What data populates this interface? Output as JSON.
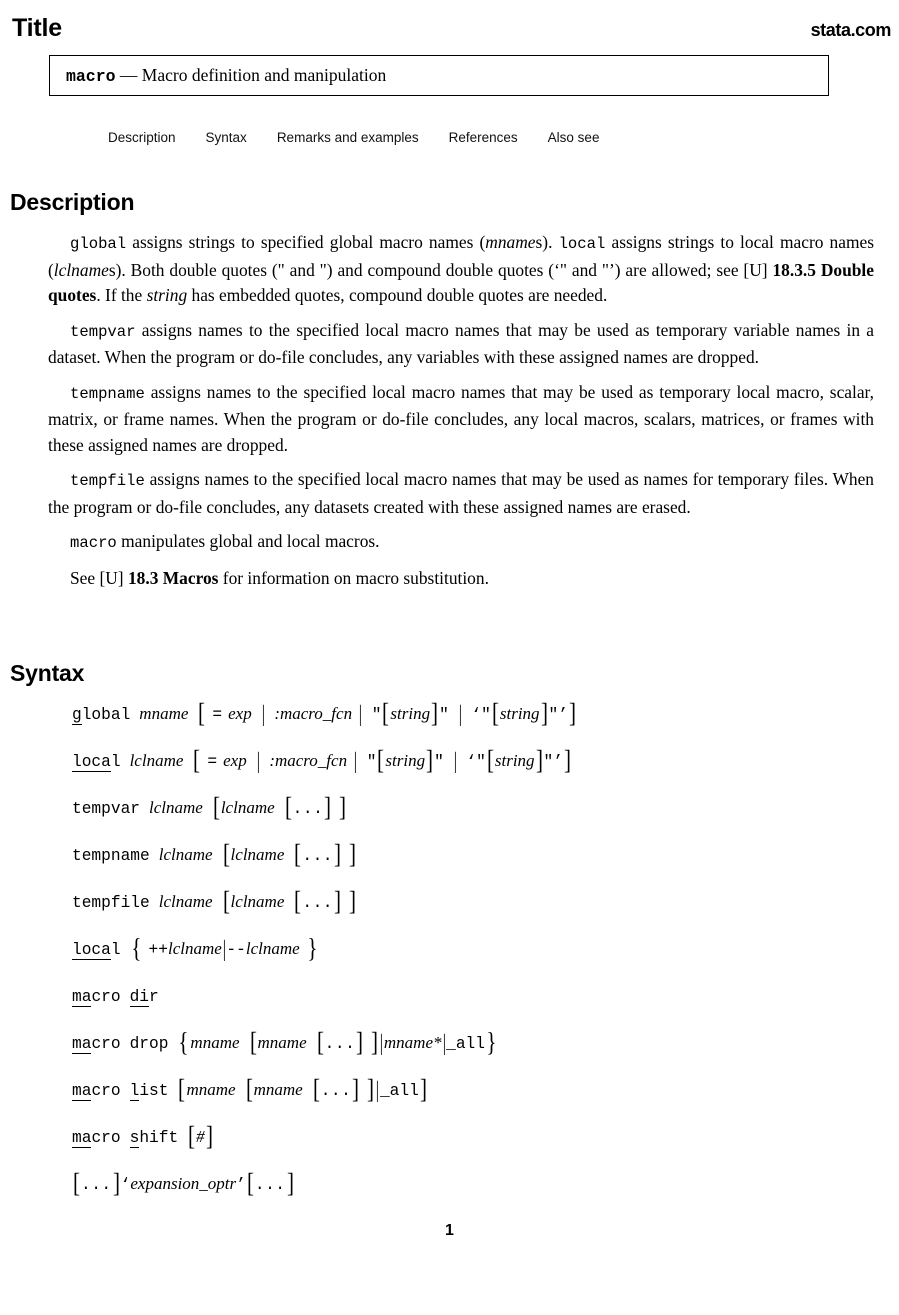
{
  "header": {
    "title": "Title",
    "logo": "stata.com"
  },
  "title_box": {
    "command": "macro",
    "dash": "—",
    "description": "Macro definition and manipulation"
  },
  "nav": {
    "items": [
      {
        "label": "Description"
      },
      {
        "label": "Syntax"
      },
      {
        "label": "Remarks and examples"
      },
      {
        "label": "References"
      },
      {
        "label": "Also see"
      }
    ]
  },
  "sections": {
    "description_heading": "Description",
    "syntax_heading": "Syntax"
  },
  "description": {
    "p1": {
      "s1": "global",
      "s2": " assigns strings to specified global macro names (",
      "s3": "mname",
      "s4": "s). ",
      "s5": "local",
      "s6": " assigns strings to local macro names (",
      "s7": "lclname",
      "s8": "s). Both double quotes (\" and \") and compound double quotes (‘\" and \"’) are allowed; see [U] ",
      "s9": "18.3.5 Double quotes",
      "s10": ". If the ",
      "s11": "string",
      "s12": " has embedded quotes, compound double quotes are needed."
    },
    "p2": {
      "s1": "tempvar",
      "s2": " assigns names to the specified local macro names that may be used as temporary variable names in a dataset. When the program or do-file concludes, any variables with these assigned names are dropped."
    },
    "p3": {
      "s1": "tempname",
      "s2": " assigns names to the specified local macro names that may be used as temporary local macro, scalar, matrix, or frame names. When the program or do-file concludes, any local macros, scalars, matrices, or frames with these assigned names are dropped."
    },
    "p4": {
      "s1": "tempfile",
      "s2": " assigns names to the specified local macro names that may be used as names for temporary files. When the program or do-file concludes, any datasets created with these assigned names are erased."
    },
    "p5": {
      "s1": "macro",
      "s2": " manipulates global and local macros."
    },
    "p6": {
      "s1": "See [U] ",
      "s2": "18.3 Macros",
      "s3": " for information on macro substitution."
    }
  },
  "syntax": {
    "line_global": {
      "kw_u": "g",
      "kw_rest": "lobal",
      "arg1": "mname",
      "open1": "[",
      "eq": "=",
      "exp": "exp",
      "bar1": "|",
      "macro_fcn": ":macro_fcn",
      "bar2": "|",
      "quote_open": "\"",
      "open2": "[",
      "string1": "string",
      "close2": "]",
      "quote_close": "\"",
      "bar3": "|",
      "cquote_open": "‘\"",
      "open3": "[",
      "string2": "string",
      "close3": "]",
      "cquote_close": "\"’",
      "close1": "]"
    },
    "line_local": {
      "kw_u": "loca",
      "kw_rest": "l",
      "arg1": "lclname",
      "open1": "[",
      "eq": "=",
      "exp": "exp",
      "bar1": "|",
      "macro_fcn": ":macro_fcn",
      "bar2": "|",
      "quote_open": "\"",
      "open2": "[",
      "string1": "string",
      "close2": "]",
      "quote_close": "\"",
      "bar3": "|",
      "cquote_open": "‘\"",
      "open3": "[",
      "string2": "string",
      "close3": "]",
      "cquote_close": "\"’",
      "close1": "]"
    },
    "line_tempvar": {
      "kw": "tempvar",
      "arg1": "lclname",
      "open1": "[",
      "arg2": "lclname",
      "open2": "[",
      "dots": "...",
      "close2": "]",
      "close1": "]"
    },
    "line_tempname": {
      "kw": "tempname",
      "arg1": "lclname",
      "open1": "[",
      "arg2": "lclname",
      "open2": "[",
      "dots": "...",
      "close2": "]",
      "close1": "]"
    },
    "line_tempfile": {
      "kw": "tempfile",
      "arg1": "lclname",
      "open1": "[",
      "arg2": "lclname",
      "open2": "[",
      "dots": "...",
      "close2": "]",
      "close1": "]"
    },
    "line_local_incr": {
      "kw_u": "loca",
      "kw_rest": "l",
      "brace_open": "{",
      "incr": "++",
      "arg1": "lclname",
      "bar1": "|",
      "decr": "--",
      "arg2": "lclname",
      "brace_close": "}"
    },
    "line_macro_dir": {
      "kw_u": "ma",
      "kw_rest": "cro",
      "sub_u": "di",
      "sub_rest": "r"
    },
    "line_macro_drop": {
      "kw_u": "ma",
      "kw_rest": "cro",
      "sub": "drop",
      "brace_open": "{",
      "arg1": "mname",
      "open1": "[",
      "arg2": "mname",
      "open2": "[",
      "dots": "...",
      "close2": "]",
      "close1": "]",
      "bar1": "|",
      "arg3": "mname*",
      "bar2": "|",
      "all": "_all",
      "brace_close": "}"
    },
    "line_macro_list": {
      "kw_u": "ma",
      "kw_rest": "cro",
      "sub_u": "l",
      "sub_rest": "ist",
      "open1": "[",
      "arg1": "mname",
      "open2": "[",
      "arg2": "mname",
      "open3": "[",
      "dots": "...",
      "close3": "]",
      "close2": "]",
      "bar1": "|",
      "all": "_all",
      "close1": "]"
    },
    "line_macro_shift": {
      "kw_u": "ma",
      "kw_rest": "cro",
      "sub_u": "s",
      "sub_rest": "hift",
      "open1": "[",
      "hash": "#",
      "close1": "]"
    },
    "line_expansion": {
      "open1": "[",
      "dots1": "...",
      "close1": "]",
      "quote_open": "‘",
      "optr": "expansion_optr",
      "quote_close": "’",
      "open2": "[",
      "dots2": "...",
      "close2": "]"
    }
  },
  "footer": {
    "page_number": "1"
  }
}
